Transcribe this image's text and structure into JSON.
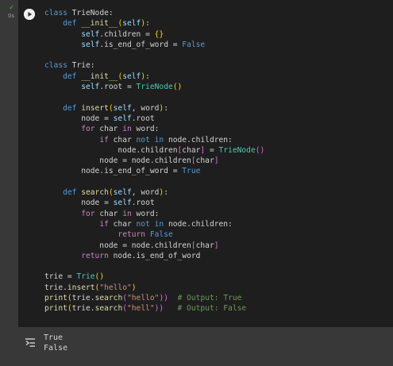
{
  "cell": {
    "status_icon": "check-icon",
    "status_color": "#4caf50",
    "execution_time": "0s",
    "run_button_icon": "play-icon"
  },
  "code_lines": [
    [
      [
        "kw",
        "class"
      ],
      [
        "plain",
        " TrieNode:"
      ]
    ],
    [
      [
        "plain",
        "    "
      ],
      [
        "kw",
        "def"
      ],
      [
        "plain",
        " "
      ],
      [
        "fn",
        "__init__"
      ],
      [
        "brk",
        "("
      ],
      [
        "self",
        "self"
      ],
      [
        "brk",
        ")"
      ],
      [
        "plain",
        ":"
      ]
    ],
    [
      [
        "plain",
        "        "
      ],
      [
        "self",
        "self"
      ],
      [
        "plain",
        ".children = "
      ],
      [
        "brk",
        "{}"
      ]
    ],
    [
      [
        "plain",
        "        "
      ],
      [
        "self",
        "self"
      ],
      [
        "plain",
        ".is_end_of_word = "
      ],
      [
        "bool",
        "False"
      ]
    ],
    [
      [
        "plain",
        ""
      ]
    ],
    [
      [
        "kw",
        "class"
      ],
      [
        "plain",
        " Trie:"
      ]
    ],
    [
      [
        "plain",
        "    "
      ],
      [
        "kw",
        "def"
      ],
      [
        "plain",
        " "
      ],
      [
        "fn",
        "__init__"
      ],
      [
        "brk",
        "("
      ],
      [
        "self",
        "self"
      ],
      [
        "brk",
        ")"
      ],
      [
        "plain",
        ":"
      ]
    ],
    [
      [
        "plain",
        "        "
      ],
      [
        "self",
        "self"
      ],
      [
        "plain",
        ".root = "
      ],
      [
        "cls",
        "TrieNode"
      ],
      [
        "brk",
        "()"
      ]
    ],
    [
      [
        "plain",
        ""
      ]
    ],
    [
      [
        "plain",
        "    "
      ],
      [
        "kw",
        "def"
      ],
      [
        "plain",
        " "
      ],
      [
        "fn",
        "insert"
      ],
      [
        "brk",
        "("
      ],
      [
        "self",
        "self"
      ],
      [
        "plain",
        ", word"
      ],
      [
        "brk",
        ")"
      ],
      [
        "plain",
        ":"
      ]
    ],
    [
      [
        "plain",
        "        node = "
      ],
      [
        "self",
        "self"
      ],
      [
        "plain",
        ".root"
      ]
    ],
    [
      [
        "plain",
        "        "
      ],
      [
        "kw2",
        "for"
      ],
      [
        "plain",
        " char "
      ],
      [
        "kw2",
        "in"
      ],
      [
        "plain",
        " word:"
      ]
    ],
    [
      [
        "plain",
        "            "
      ],
      [
        "kw2",
        "if"
      ],
      [
        "plain",
        " char "
      ],
      [
        "kw",
        "not in"
      ],
      [
        "plain",
        " node.children:"
      ]
    ],
    [
      [
        "plain",
        "                node.children"
      ],
      [
        "brk2",
        "["
      ],
      [
        "plain",
        "char"
      ],
      [
        "brk2",
        "]"
      ],
      [
        "plain",
        " = "
      ],
      [
        "cls",
        "TrieNode"
      ],
      [
        "brk2",
        "()"
      ]
    ],
    [
      [
        "plain",
        "            node = node.children"
      ],
      [
        "brk2",
        "["
      ],
      [
        "plain",
        "char"
      ],
      [
        "brk2",
        "]"
      ]
    ],
    [
      [
        "plain",
        "        node.is_end_of_word = "
      ],
      [
        "bool",
        "True"
      ]
    ],
    [
      [
        "plain",
        ""
      ]
    ],
    [
      [
        "plain",
        "    "
      ],
      [
        "kw",
        "def"
      ],
      [
        "plain",
        " "
      ],
      [
        "fn",
        "search"
      ],
      [
        "brk",
        "("
      ],
      [
        "self",
        "self"
      ],
      [
        "plain",
        ", word"
      ],
      [
        "brk",
        ")"
      ],
      [
        "plain",
        ":"
      ]
    ],
    [
      [
        "plain",
        "        node = "
      ],
      [
        "self",
        "self"
      ],
      [
        "plain",
        ".root"
      ]
    ],
    [
      [
        "plain",
        "        "
      ],
      [
        "kw2",
        "for"
      ],
      [
        "plain",
        " char "
      ],
      [
        "kw2",
        "in"
      ],
      [
        "plain",
        " word:"
      ]
    ],
    [
      [
        "plain",
        "            "
      ],
      [
        "kw2",
        "if"
      ],
      [
        "plain",
        " char "
      ],
      [
        "kw",
        "not in"
      ],
      [
        "plain",
        " node.children:"
      ]
    ],
    [
      [
        "plain",
        "                "
      ],
      [
        "kw2",
        "return"
      ],
      [
        "plain",
        " "
      ],
      [
        "bool",
        "False"
      ]
    ],
    [
      [
        "plain",
        "            node = node.children"
      ],
      [
        "brk2",
        "["
      ],
      [
        "plain",
        "char"
      ],
      [
        "brk2",
        "]"
      ]
    ],
    [
      [
        "plain",
        "        "
      ],
      [
        "kw2",
        "return"
      ],
      [
        "plain",
        " node.is_end_of_word"
      ]
    ],
    [
      [
        "plain",
        ""
      ]
    ],
    [
      [
        "plain",
        "trie = "
      ],
      [
        "cls",
        "Trie"
      ],
      [
        "brk",
        "()"
      ]
    ],
    [
      [
        "plain",
        "trie."
      ],
      [
        "fn",
        "insert"
      ],
      [
        "brk",
        "("
      ],
      [
        "str",
        "\"hello\""
      ],
      [
        "brk",
        ")"
      ]
    ],
    [
      [
        "fn",
        "print"
      ],
      [
        "brk",
        "("
      ],
      [
        "plain",
        "trie."
      ],
      [
        "fn",
        "search"
      ],
      [
        "brk2",
        "("
      ],
      [
        "str",
        "\"hello\""
      ],
      [
        "brk2",
        "))"
      ],
      [
        "plain",
        "  "
      ],
      [
        "com",
        "# Output: True"
      ]
    ],
    [
      [
        "fn",
        "print"
      ],
      [
        "brk",
        "("
      ],
      [
        "plain",
        "trie."
      ],
      [
        "fn",
        "search"
      ],
      [
        "brk2",
        "("
      ],
      [
        "str",
        "\"hell\""
      ],
      [
        "brk2",
        "))"
      ],
      [
        "plain",
        "   "
      ],
      [
        "com",
        "# Output: False"
      ]
    ]
  ],
  "output": {
    "icon": "output-toggle-icon",
    "lines": [
      "True",
      "False"
    ]
  }
}
